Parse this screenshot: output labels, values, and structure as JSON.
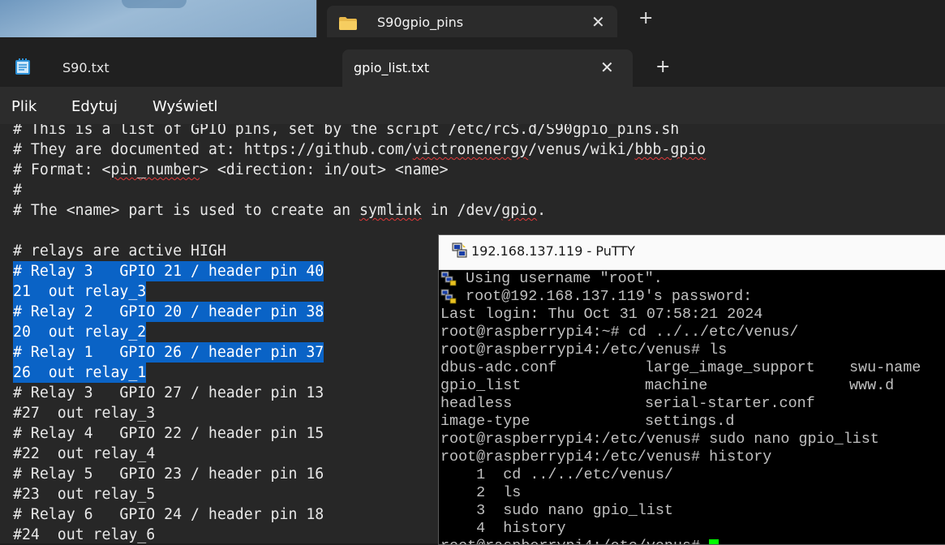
{
  "explorer": {
    "tab_label": "S90gpio_pins",
    "folder_icon": "folder-icon",
    "close_icon": "close-icon",
    "new_tab_icon": "plus-icon"
  },
  "notepad": {
    "app_icon": "notepad-icon",
    "tabs": [
      {
        "label": "S90.txt"
      },
      {
        "label": "gpio_list.txt"
      }
    ],
    "menu": [
      {
        "label": "Plik"
      },
      {
        "label": "Edytuj"
      },
      {
        "label": "Wyświetl"
      }
    ],
    "lines": [
      {
        "text": "# This is a list of GPIO pins, set by the script /etc/rcS.d/S90gpio_pins.sh"
      },
      {
        "pre": "# They are documented at: https://github.com/",
        "sq1": "victronenergy",
        "mid": "/venus/wiki/",
        "sq2": "bbb-gpio"
      },
      {
        "pre": "# Format: <",
        "sq1": "pin_number",
        "mid": "> <direction: in/out> <name>"
      },
      {
        "text": "#"
      },
      {
        "pre": "# The <name> part is used to create an ",
        "sq1": "symlink",
        "mid": " in /dev/",
        "sq2": "gpio",
        "post": "."
      },
      {
        "text": ""
      },
      {
        "text": "# relays are active HIGH"
      },
      {
        "text": "# Relay 3   GPIO 21 / header pin 40",
        "selected": true
      },
      {
        "text": "21  out relay_3",
        "selected": true
      },
      {
        "text": "# Relay 2   GPIO 20 / header pin 38",
        "selected": true
      },
      {
        "text": "20  out relay_2",
        "selected": true
      },
      {
        "text": "# Relay 1   GPIO 26 / header pin 37",
        "selected": true
      },
      {
        "text": "26  out relay_1",
        "selected": true
      },
      {
        "text": "# Relay 3   GPIO 27 / header pin 13"
      },
      {
        "text": "#27  out relay_3"
      },
      {
        "text": "# Relay 4   GPIO 22 / header pin 15"
      },
      {
        "text": "#22  out relay_4"
      },
      {
        "text": "# Relay 5   GPIO 23 / header pin 16"
      },
      {
        "text": "#23  out relay_5"
      },
      {
        "text": "# Relay 6   GPIO 24 / header pin 18"
      },
      {
        "text": "#24  out relay_6"
      }
    ]
  },
  "putty": {
    "title": "192.168.137.119 - PuTTY",
    "app_icon": "putty-icon",
    "lines": [
      {
        "text": " Using username \"root\".",
        "key": true
      },
      {
        "text": " root@192.168.137.119's password:",
        "key": true
      },
      {
        "text": "Last login: Thu Oct 31 07:58:21 2024"
      },
      {
        "text": "root@raspberrypi4:~# cd ../../etc/venus/"
      },
      {
        "text": "root@raspberrypi4:/etc/venus# ls"
      },
      {
        "cols": [
          "dbus-adc.conf",
          "large_image_support",
          "swu-name"
        ]
      },
      {
        "cols": [
          "gpio_list",
          "machine",
          "www.d"
        ]
      },
      {
        "cols": [
          "headless",
          "serial-starter.conf",
          ""
        ]
      },
      {
        "cols": [
          "image-type",
          "settings.d",
          ""
        ]
      },
      {
        "text": "root@raspberrypi4:/etc/venus# sudo nano gpio_list"
      },
      {
        "text": "root@raspberrypi4:/etc/venus# history"
      },
      {
        "text": "    1  cd ../../etc/venus/"
      },
      {
        "text": "    2  ls"
      },
      {
        "text": "    3  sudo nano gpio_list"
      },
      {
        "text": "    4  history"
      },
      {
        "text": "root@raspberrypi4:/etc/venus# ",
        "cursor": true
      }
    ]
  }
}
